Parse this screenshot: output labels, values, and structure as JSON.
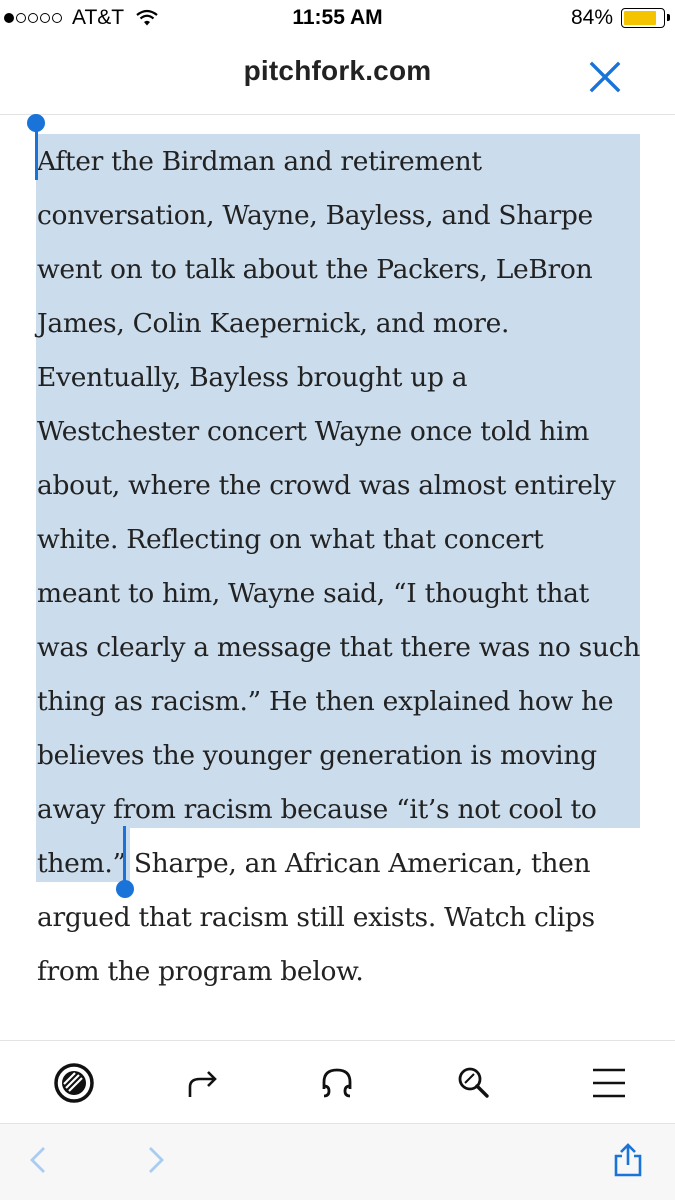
{
  "status_bar": {
    "carrier": "AT&T",
    "time": "11:55 AM",
    "battery_percent": "84%",
    "battery_level": 0.84,
    "signal_bars_filled": 1,
    "signal_bars_total": 5
  },
  "header": {
    "domain": "pitchfork.com",
    "close_icon": "close-x-icon"
  },
  "article": {
    "lines": [
      "After the Birdman and retirement",
      "conversation, Wayne, Bayless, and Sharpe",
      "went on to talk about the Packers, LeBron",
      "James, Colin Kaepernick, and more.",
      "Eventually, Bayless brought up a",
      "Westchester concert Wayne once told him",
      "about, where the crowd was almost entirely",
      "white. Reflecting on what that concert",
      "meant to him, Wayne said, “I thought that",
      "was clearly a message that there was no such",
      "thing as racism.” He then explained how he",
      "believes the younger generation is moving",
      "away from racism because “it’s not cool to",
      "them.” Sharpe, an African American, then",
      "argued that racism still exists. Watch clips",
      "from the program below."
    ]
  },
  "toolbar": {
    "items": [
      "pitchfork-logo-icon",
      "share-arrow-icon",
      "headphones-icon",
      "search-icon",
      "menu-icon"
    ]
  },
  "browser_bar": {
    "items": [
      "back-chevron-icon",
      "forward-chevron-icon",
      "share-icon"
    ]
  },
  "colors": {
    "selection": "#cbdcec",
    "cursor": "#1a73d8",
    "accent": "#1a73d8",
    "battery": "#f5c400",
    "nav_disabled": "#a9cdf2"
  }
}
